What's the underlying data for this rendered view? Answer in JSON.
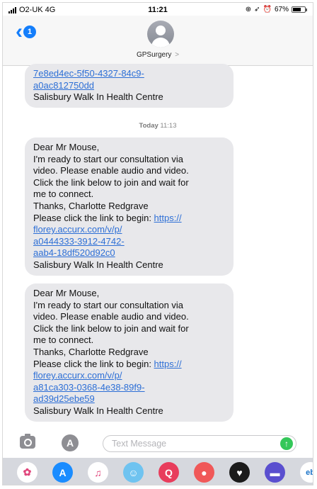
{
  "status": {
    "carrier": "O2-UK 4G",
    "time": "11:21",
    "battery": "67%",
    "battery_level": 0.67
  },
  "header": {
    "back_badge": "1",
    "contact_name": "GPSurgery",
    "chevron": ">"
  },
  "messages": [
    {
      "lines": [
        {
          "text": "7e8ed4ec-5f50-4327-84c9-",
          "link": true
        },
        {
          "text": "a0ac812750dd",
          "link": true
        },
        {
          "text": "Salisbury Walk In Health Centre",
          "link": false
        }
      ]
    },
    {
      "lines": [
        {
          "text": "Dear Mr Mouse,",
          "link": false
        },
        {
          "text": "I'm ready to start our consultation via",
          "link": false
        },
        {
          "text": "video. Please enable audio and video.",
          "link": false
        },
        {
          "text": "Click the link below to join and wait for",
          "link": false
        },
        {
          "text": "me to connect.",
          "link": false
        },
        {
          "text": "Thanks, Charlotte Redgrave",
          "link": false
        },
        {
          "text": "Please click the link to begin: ",
          "link": false,
          "link_suffix": "https://"
        },
        {
          "text": "florey.accurx.com/v/p/",
          "link": true
        },
        {
          "text": "a0444333-3912-4742-",
          "link": true
        },
        {
          "text": "aab4-18df520d92c0",
          "link": true
        },
        {
          "text": "Salisbury Walk In Health Centre",
          "link": false
        }
      ]
    },
    {
      "lines": [
        {
          "text": "Dear Mr Mouse,",
          "link": false
        },
        {
          "text": "I'm ready to start our consultation via",
          "link": false
        },
        {
          "text": "video. Please enable audio and video.",
          "link": false
        },
        {
          "text": "Click the link below to join and wait for",
          "link": false
        },
        {
          "text": "me to connect.",
          "link": false
        },
        {
          "text": "Thanks, Charlotte Redgrave",
          "link": false
        },
        {
          "text": "Please click the link to begin: ",
          "link": false,
          "link_suffix": "https://"
        },
        {
          "text": "florey.accurx.com/v/p/",
          "link": true
        },
        {
          "text": "a81ca303-0368-4e38-89f9-",
          "link": true
        },
        {
          "text": "ad39d25ebe59",
          "link": true
        },
        {
          "text": "Salisbury Walk In Health Centre",
          "link": false
        }
      ]
    }
  ],
  "timestamp": {
    "day": "Today",
    "time": "11:13"
  },
  "input": {
    "placeholder": "Text Message"
  },
  "icons": {
    "camera": "camera-icon",
    "apps": "app-store-icon",
    "send": "send-arrow-icon"
  },
  "app_strip": [
    {
      "name": "photos-app",
      "color": "#ffffff",
      "glyph": "✿"
    },
    {
      "name": "app-store-app",
      "color": "#1a8cff",
      "glyph": "A"
    },
    {
      "name": "music-app",
      "color": "#ffffff",
      "glyph": "♫"
    },
    {
      "name": "memoji-app",
      "color": "#6fc3f0",
      "glyph": "☺"
    },
    {
      "name": "images-search-app",
      "color": "#e83d5c",
      "glyph": "Q"
    },
    {
      "name": "red-app",
      "color": "#f05858",
      "glyph": "●"
    },
    {
      "name": "digital-touch-app",
      "color": "#1b1b1b",
      "glyph": "♥"
    },
    {
      "name": "purple-app",
      "color": "#5a4fcf",
      "glyph": "▬"
    },
    {
      "name": "partial-app",
      "color": "#ffffff",
      "glyph": "eb"
    }
  ]
}
